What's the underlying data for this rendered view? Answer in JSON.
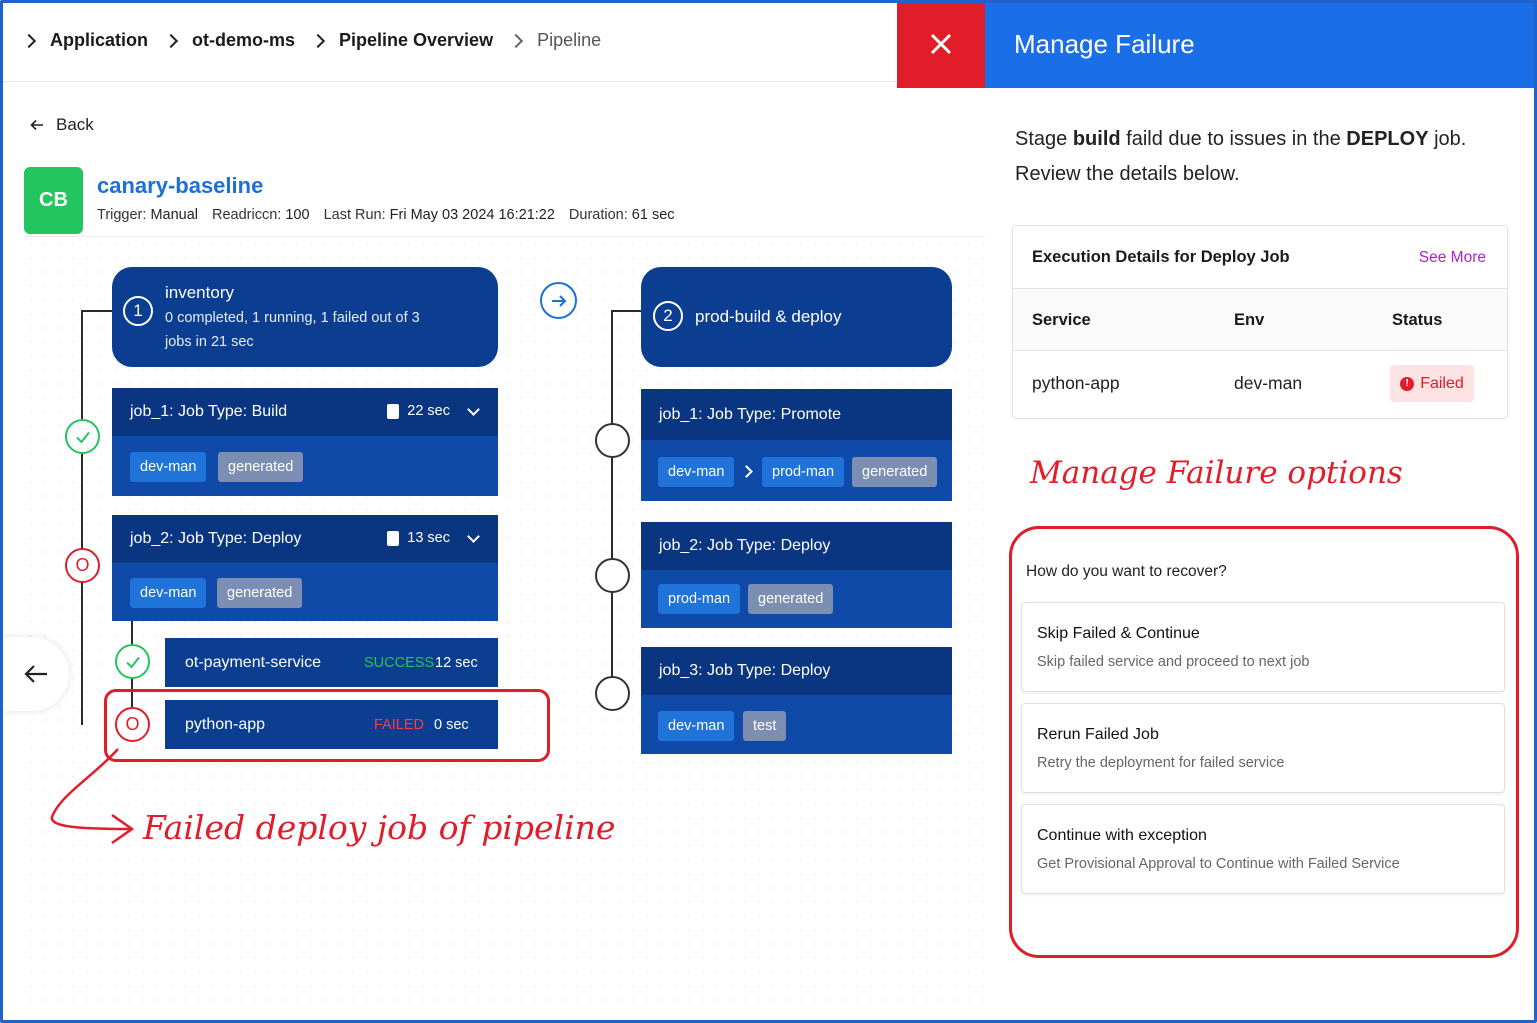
{
  "breadcrumb": [
    "Application",
    "ot-demo-ms",
    "Pipeline Overview",
    "Pipeline"
  ],
  "back_label": "Back",
  "pipeline": {
    "avatar": "CB",
    "name": "canary-baseline",
    "trigger_label": "Trigger:",
    "trigger": "Manual",
    "readriccn_label": "Readriccn:",
    "readriccn": "100",
    "last_run_label": "Last Run:",
    "last_run": "Fri May 03 2024 16:21:22",
    "duration_label": "Duration:",
    "duration": "61 sec"
  },
  "stage1": {
    "num": "1",
    "title": "inventory",
    "sub1": "0 completed, 1 running, 1 failed out of 3",
    "sub2": "jobs in 21 sec",
    "jobs": [
      {
        "title": "job_1: Job Type: Build",
        "duration": "22 sec",
        "tags": [
          "dev-man",
          "generated"
        ]
      },
      {
        "title": "job_2: Job Type: Deploy",
        "duration": "13 sec",
        "tags": [
          "dev-man",
          "generated"
        ]
      }
    ],
    "services": [
      {
        "name": "ot-payment-service",
        "status": "SUCCESS",
        "time": "12 sec"
      },
      {
        "name": "python-app",
        "status": "FAILED",
        "time": "0 sec"
      }
    ]
  },
  "stage2": {
    "num": "2",
    "title": "prod-build & deploy",
    "jobs": [
      {
        "title": "job_1: Job Type: Promote",
        "tags": [
          "dev-man",
          "prod-man",
          "generated"
        ]
      },
      {
        "title": "job_2: Job Type: Deploy",
        "tags": [
          "prod-man",
          "generated"
        ]
      },
      {
        "title": "job_3: Job Type: Deploy",
        "tags": [
          "dev-man",
          "test"
        ]
      }
    ]
  },
  "annotations": {
    "failed_job": "Failed deploy job of pipeline",
    "options": "Manage Failure options"
  },
  "panel": {
    "title": "Manage Failure",
    "intro_1": "Stage ",
    "intro_stage": "build",
    "intro_2": " faild due to issues in the ",
    "intro_job": "DEPLOY",
    "intro_3": " job.",
    "intro_4": "Review the details below.",
    "exec_title": "Execution Details for Deploy Job",
    "see_more": "See More",
    "columns": [
      "Service",
      "Env",
      "Status"
    ],
    "row": {
      "service": "python-app",
      "env": "dev-man",
      "status": "Failed"
    },
    "question": "How do you want to recover?",
    "options": [
      {
        "title": "Skip Failed & Continue",
        "desc": "Skip failed service and proceed to next job"
      },
      {
        "title": "Rerun Failed Job",
        "desc": "Retry the deployment for failed service"
      },
      {
        "title": "Continue with exception",
        "desc": "Get Provisional Approval to Continue with Failed Service"
      }
    ]
  },
  "colors": {
    "primary": "#1a6fe8",
    "stage_blue": "#0b3d91",
    "danger": "#e11d2a",
    "success": "#22c55e",
    "avatar_green": "#22c55e"
  }
}
